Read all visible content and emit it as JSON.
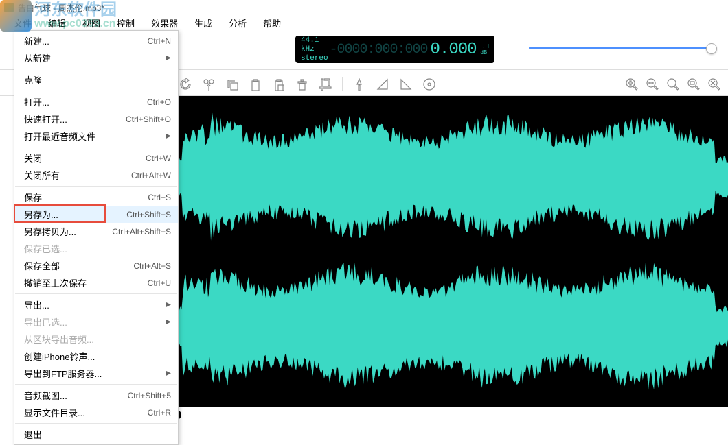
{
  "title": "告白气球 - 周杰伦.mp3*",
  "watermark": {
    "cn": "河东软件园",
    "url": "www.pc0359.cn"
  },
  "menubar": [
    "文件",
    "编辑",
    "视图",
    "控制",
    "效果器",
    "生成",
    "分析",
    "帮助"
  ],
  "lcd": {
    "rate": "44.1 kHz",
    "mode": "stereo",
    "time": "-0000:000:000",
    "value": "0.000",
    "side1": "I←I",
    "side2": "dB"
  },
  "toolbar_icons": [
    "redo-icon",
    "cut-icon",
    "copy-icon",
    "paste-icon",
    "paste-over-icon",
    "delete-icon",
    "crop-icon",
    "",
    "marker-icon",
    "fade-in-icon",
    "fade-out-icon",
    "disc-icon"
  ],
  "zoom_icons": [
    "zoom-in-icon",
    "zoom-out-icon",
    "zoom-fit-icon",
    "zoom-sel-icon",
    "zoom-x-icon"
  ],
  "file_menu": [
    {
      "type": "item",
      "label": "新建...",
      "shortcut": "Ctrl+N"
    },
    {
      "type": "item",
      "label": "从新建",
      "submenu": true
    },
    {
      "type": "sep"
    },
    {
      "type": "item",
      "label": "克隆"
    },
    {
      "type": "sep"
    },
    {
      "type": "item",
      "label": "打开...",
      "shortcut": "Ctrl+O"
    },
    {
      "type": "item",
      "label": "快速打开...",
      "shortcut": "Ctrl+Shift+O"
    },
    {
      "type": "item",
      "label": "打开最近音频文件",
      "submenu": true
    },
    {
      "type": "sep"
    },
    {
      "type": "item",
      "label": "关闭",
      "shortcut": "Ctrl+W"
    },
    {
      "type": "item",
      "label": "关闭所有",
      "shortcut": "Ctrl+Alt+W"
    },
    {
      "type": "sep"
    },
    {
      "type": "item",
      "label": "保存",
      "shortcut": "Ctrl+S"
    },
    {
      "type": "item",
      "label": "另存为...",
      "shortcut": "Ctrl+Shift+S",
      "highlighted": true,
      "redbox": true
    },
    {
      "type": "item",
      "label": "另存拷贝为...",
      "shortcut": "Ctrl+Alt+Shift+S"
    },
    {
      "type": "item",
      "label": "保存已选...",
      "disabled": true
    },
    {
      "type": "item",
      "label": "保存全部",
      "shortcut": "Ctrl+Alt+S"
    },
    {
      "type": "item",
      "label": "撤销至上次保存",
      "shortcut": "Ctrl+U"
    },
    {
      "type": "sep"
    },
    {
      "type": "item",
      "label": "导出...",
      "submenu": true
    },
    {
      "type": "item",
      "label": "导出已选...",
      "disabled": true,
      "submenu": true
    },
    {
      "type": "item",
      "label": "从区块导出音频...",
      "disabled": true
    },
    {
      "type": "item",
      "label": "创建iPhone铃声..."
    },
    {
      "type": "item",
      "label": "导出到FTP服务器...",
      "submenu": true
    },
    {
      "type": "sep"
    },
    {
      "type": "item",
      "label": "音频截图...",
      "shortcut": "Ctrl+Shift+5"
    },
    {
      "type": "item",
      "label": "显示文件目录...",
      "shortcut": "Ctrl+R"
    },
    {
      "type": "sep"
    },
    {
      "type": "item",
      "label": "退出"
    }
  ]
}
